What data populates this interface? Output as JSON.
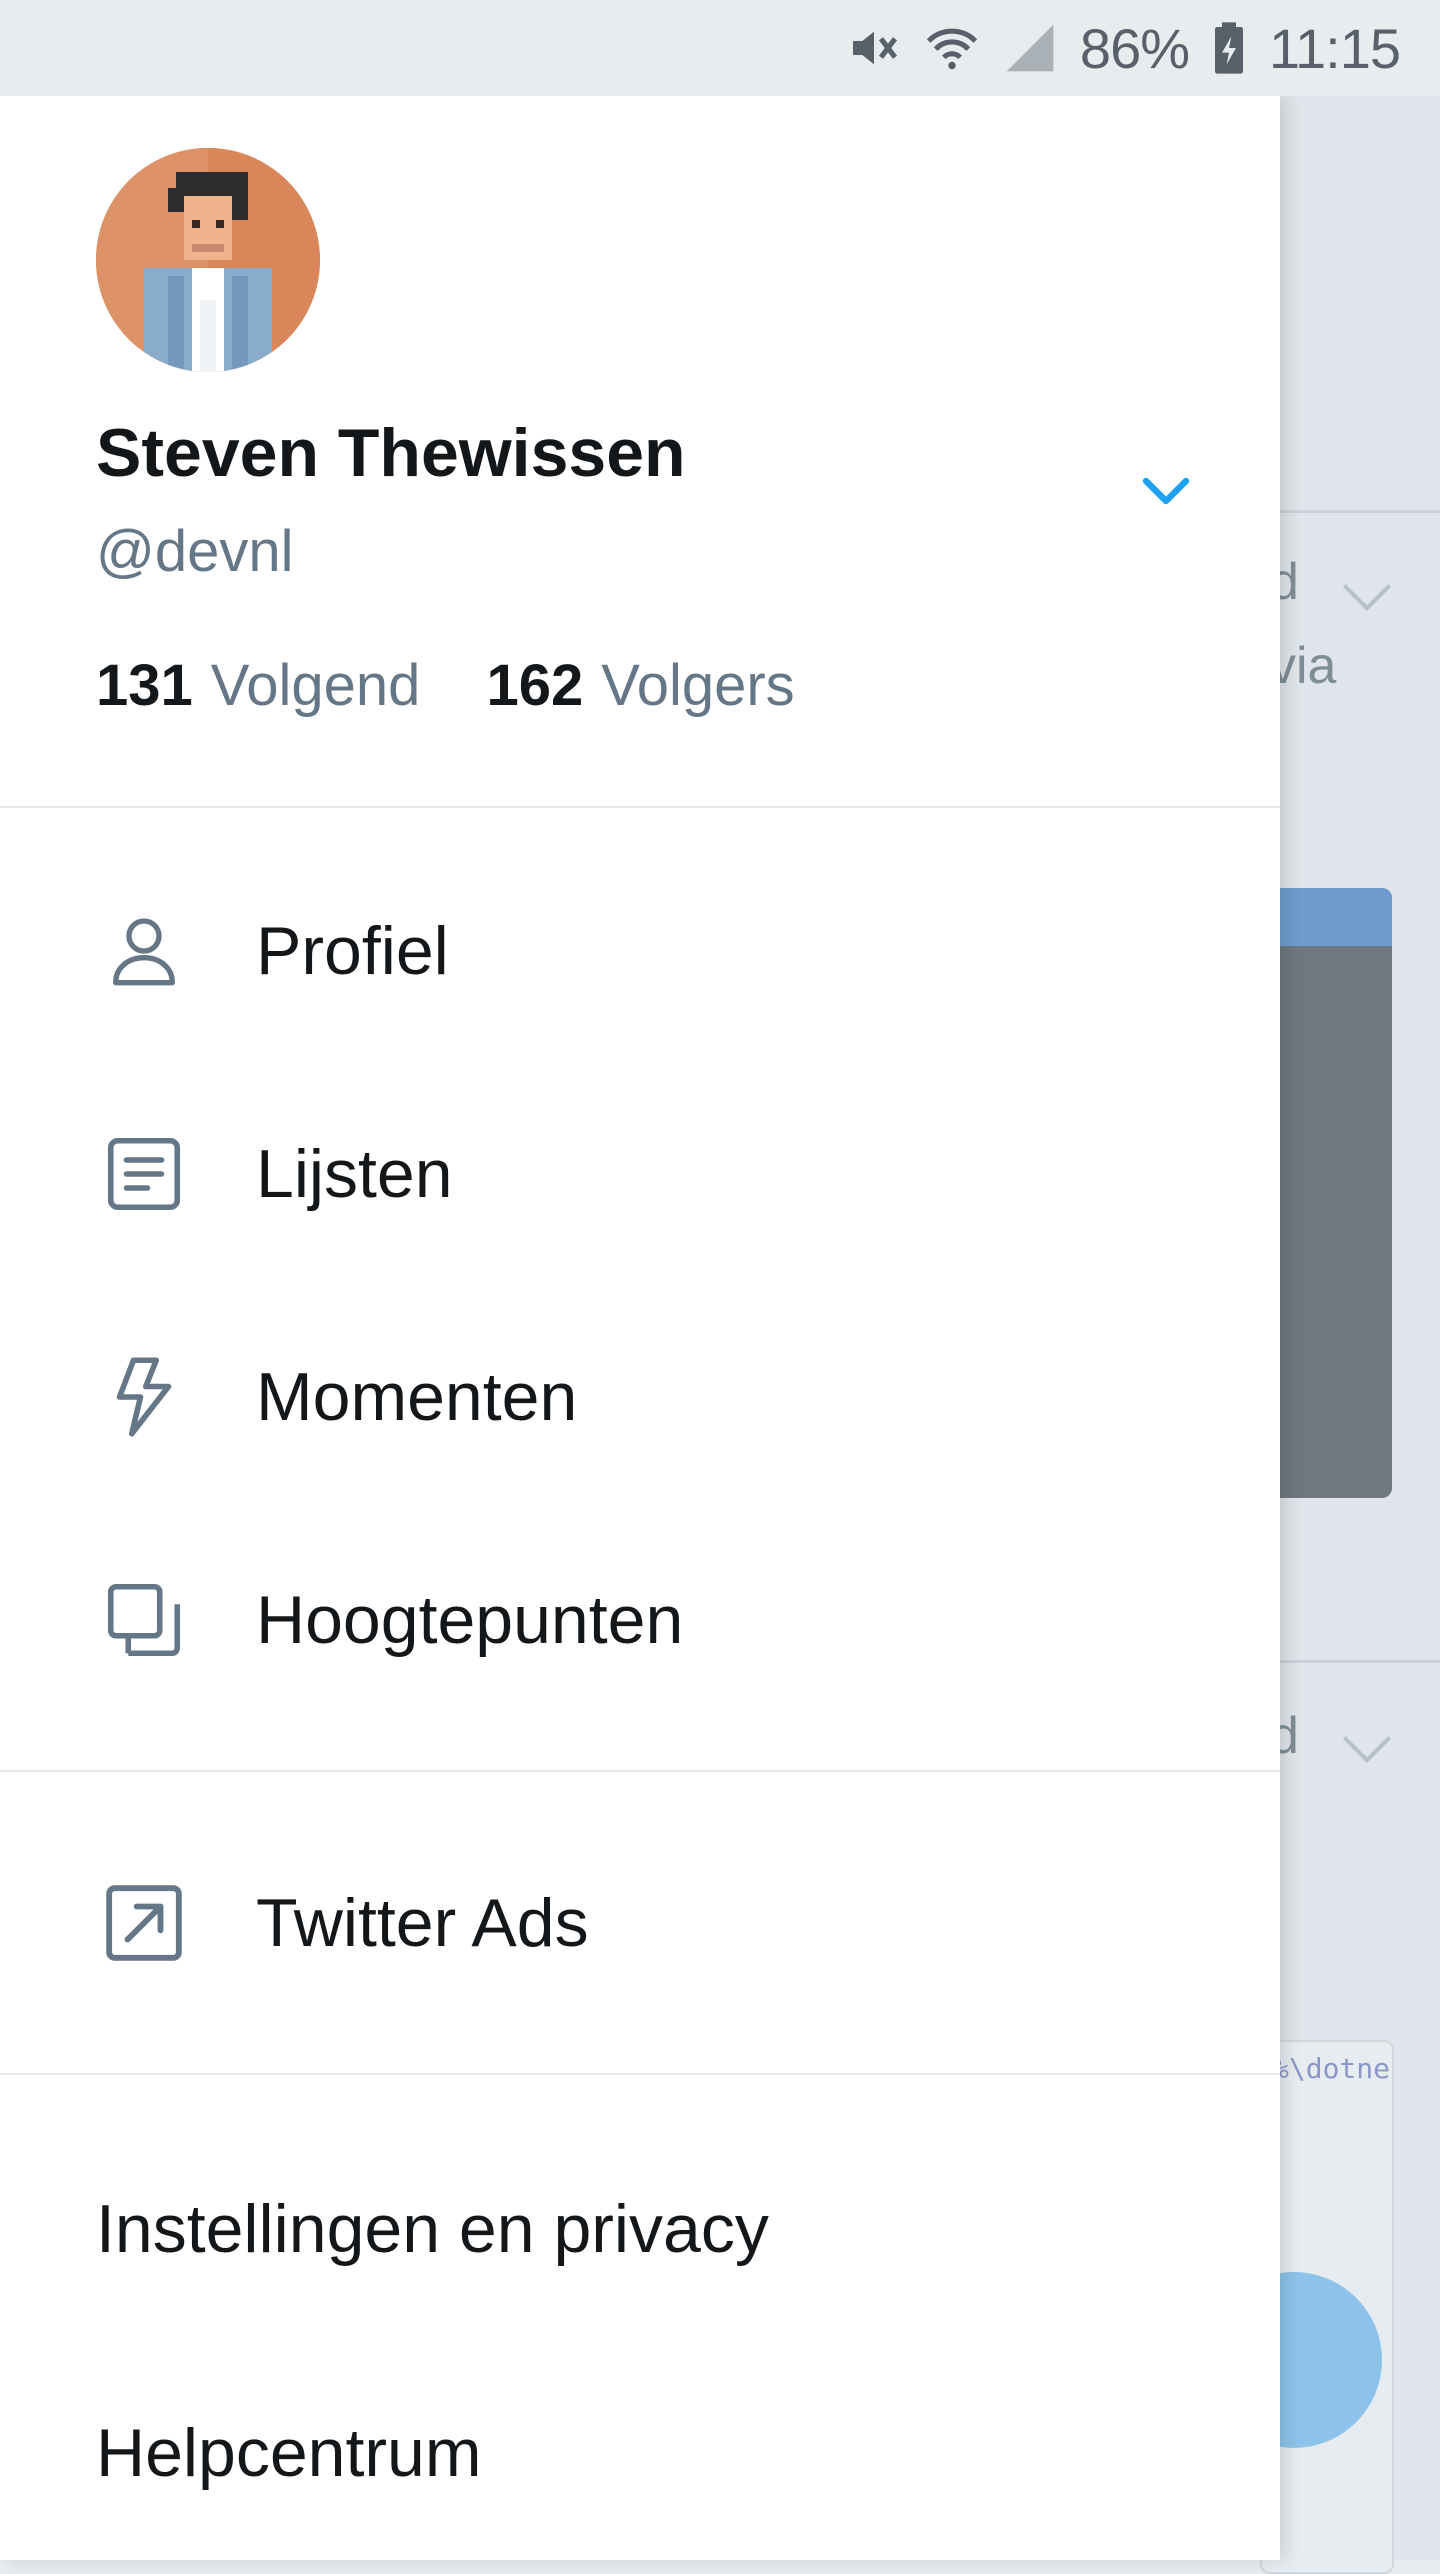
{
  "status_bar": {
    "battery": "86%",
    "time": "11:15",
    "icons": [
      "mute-icon",
      "wifi-icon",
      "signal-icon",
      "battery-icon"
    ]
  },
  "profile": {
    "name": "Steven Thewissen",
    "handle": "@devnl",
    "following_count": "131",
    "following_label": "Volgend",
    "followers_count": "162",
    "followers_label": "Volgers"
  },
  "menu": {
    "items": [
      {
        "label": "Profiel",
        "icon": "person-icon"
      },
      {
        "label": "Lijsten",
        "icon": "list-icon"
      },
      {
        "label": "Momenten",
        "icon": "lightning-icon"
      },
      {
        "label": "Hoogtepunten",
        "icon": "highlights-icon"
      }
    ],
    "ads": {
      "label": "Twitter Ads",
      "icon": "external-link-icon"
    },
    "settings_label": "Instellingen en privacy",
    "help_label": "Helpcentrum"
  },
  "background": {
    "text_fragment_1": "d",
    "text_fragment_2": "via",
    "text_fragment_3": "d",
    "code_fragment": "%\\dotne"
  },
  "colors": {
    "accent": "#1da1f2",
    "icon_gray": "#657786",
    "text_dark": "#14171a",
    "secondary_text": "#657786",
    "divider": "#e1e8ed"
  }
}
